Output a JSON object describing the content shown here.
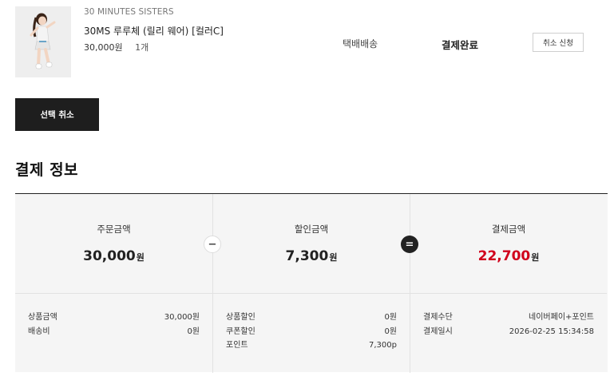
{
  "order_item": {
    "brand": "30 MINUTES SISTERS",
    "name": "30MS 루루체 (릴리 웨어) [컬러C]",
    "price": "30,000원",
    "quantity": "1개",
    "shipping": "택배배송",
    "status": "결제완료",
    "cancel_request_label": "취소 신청"
  },
  "select_cancel_label": "선택 취소",
  "payment_info": {
    "title": "결제 정보",
    "order_amount": {
      "label": "주문금액",
      "value": "30,000",
      "unit": "원"
    },
    "discount_amount": {
      "label": "할인금액",
      "value": "7,300",
      "unit": "원"
    },
    "payment_amount": {
      "label": "결제금액",
      "value": "22,700",
      "unit": "원"
    },
    "minus_symbol": "−",
    "equal_symbol": "=",
    "order_details": [
      {
        "label": "상품금액",
        "value": "30,000원"
      },
      {
        "label": "배송비",
        "value": "0원"
      }
    ],
    "discount_details": [
      {
        "label": "상품할인",
        "value": "0원"
      },
      {
        "label": "쿠폰할인",
        "value": "0원"
      },
      {
        "label": "포인트",
        "value": "7,300p"
      }
    ],
    "payment_details": [
      {
        "label": "결제수단",
        "value": "네이버페이+포인트"
      },
      {
        "label": "결제일시",
        "value": "2026-02-25 15:34:58"
      }
    ]
  },
  "colors": {
    "accent_red": "#d0001b",
    "dark_button": "#1e1e1e",
    "panel_bg": "#f5f5f5"
  }
}
